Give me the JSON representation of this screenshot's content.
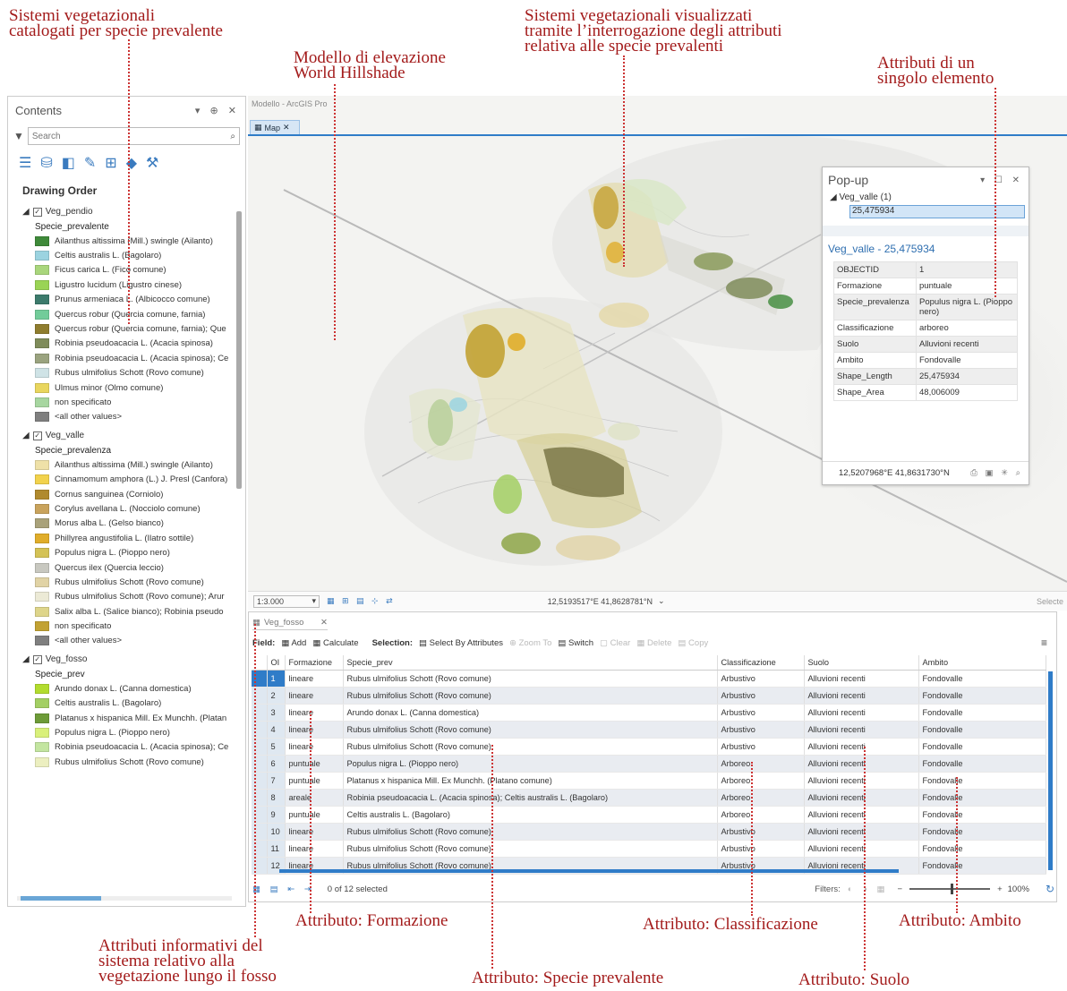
{
  "annotations": {
    "top_left": "Sistemi vegetazionali\ncatalogati per specie prevalente",
    "top_mid": "Modello di elevazione\nWorld Hillshade",
    "top_center": "Sistemi vegetazionali visualizzati\ntramite l’interrogazione degli attributi\nrelativa alle specie prevalenti",
    "top_right": "Attributi di un\nsingolo elemento",
    "bottom_formazione": "Attributo: Formazione",
    "bottom_classificazione": "Attributo: Classificazione",
    "bottom_ambito": "Attributo: Ambito",
    "bottom_left": "Attributi informativi del\nsistema relativo alla\nvegetazione lungo il fosso",
    "bottom_specie": "Attributo: Specie prevalente",
    "bottom_suolo": "Attributo: Suolo"
  },
  "contents": {
    "title": "Contents",
    "controls": "▾ ⊕ ✕",
    "search_placeholder": "Search",
    "drawing_order": "Drawing Order",
    "layers": [
      {
        "name": "Veg_pendio",
        "field": "Specie_prevalente",
        "items": [
          {
            "label": "Ailanthus altissima (Mill.) swingle (Ailanto)",
            "color": "#3f8a3a"
          },
          {
            "label": "Celtis australis L. (Bagolaro)",
            "color": "#9bd3e0"
          },
          {
            "label": "Ficus carica L. (Fico comune)",
            "color": "#a9d67c"
          },
          {
            "label": "Ligustro lucidum (Ligustro cinese)",
            "color": "#9ad455"
          },
          {
            "label": "Prunus armeniaca L. (Albicocco comune)",
            "color": "#3c7b6c"
          },
          {
            "label": "Quercus robur (Quercia comune, farnia)",
            "color": "#72cc9a"
          },
          {
            "label": "Quercus robur (Quercia comune, farnia); Que",
            "color": "#8f7d2e"
          },
          {
            "label": "Robinia pseudoacacia L. (Acacia spinosa)",
            "color": "#7f8c5a"
          },
          {
            "label": "Robinia pseudoacacia L. (Acacia spinosa); Ce",
            "color": "#9aa37f"
          },
          {
            "label": "Rubus ulmifolius Schott (Rovo comune)",
            "color": "#cfe3e6"
          },
          {
            "label": "Ulmus minor (Olmo comune)",
            "color": "#e9d65e"
          },
          {
            "label": "non specificato",
            "color": "#a7d6a0"
          },
          {
            "label": "<all other values>",
            "color": "#7f7f7f"
          }
        ]
      },
      {
        "name": "Veg_valle",
        "field": "Specie_prevalenza",
        "items": [
          {
            "label": "Ailanthus altissima (Mill.) swingle (Ailanto)",
            "color": "#efe1a8"
          },
          {
            "label": "Cinnamomum amphora (L.) J. Presl (Canfora)",
            "color": "#f2d24c"
          },
          {
            "label": "Cornus sanguinea (Corniolo)",
            "color": "#b08a2e"
          },
          {
            "label": "Corylus avellana L. (Nocciolo comune)",
            "color": "#c9a35c"
          },
          {
            "label": "Morus alba L. (Gelso bianco)",
            "color": "#a9a27a"
          },
          {
            "label": "Phillyrea angustifolia L. (Ilatro sottile)",
            "color": "#e0ad2a"
          },
          {
            "label": "Populus nigra L. (Pioppo nero)",
            "color": "#d4c255"
          },
          {
            "label": "Quercus ilex (Quercia leccio)",
            "color": "#c8c8c0"
          },
          {
            "label": "Rubus ulmifolius Schott (Rovo comune)",
            "color": "#e1d3a5"
          },
          {
            "label": "Rubus ulmifolius Schott (Rovo comune); Arur",
            "color": "#ecead6"
          },
          {
            "label": "Salix alba L. (Salice bianco); Robinia pseudo",
            "color": "#ded58a"
          },
          {
            "label": "non specificato",
            "color": "#c2a233"
          },
          {
            "label": "<all other values>",
            "color": "#7f7f7f"
          }
        ]
      },
      {
        "name": "Veg_fosso",
        "field": "Specie_prev",
        "items": [
          {
            "label": "Arundo donax L. (Canna domestica)",
            "color": "#b2dc2e"
          },
          {
            "label": "Celtis australis L. (Bagolaro)",
            "color": "#a3cf63"
          },
          {
            "label": "Platanus x hispanica Mill. Ex Munchh. (Platan",
            "color": "#6d9b38"
          },
          {
            "label": "Populus nigra L. (Pioppo nero)",
            "color": "#d9f07a"
          },
          {
            "label": "Robinia pseudoacacia L. (Acacia spinosa); Ce",
            "color": "#c3e5a0"
          },
          {
            "label": "Rubus ulmifolius Schott (Rovo comune)",
            "color": "#ecefc0"
          }
        ]
      }
    ]
  },
  "map": {
    "app_title": "Modello - ArcGIS Pro",
    "tab_label": "Map",
    "scale": "1:3.000",
    "coordinates": "12,5193517°E 41,8628781°N",
    "selected_label": "Selecte"
  },
  "popup": {
    "title": "Pop-up",
    "controls": "▾ ☐ ✕",
    "tree_layer": "◢ Veg_valle  (1)",
    "tree_value": "25,475934",
    "header": "Veg_valle - 25,475934",
    "rows": [
      {
        "k": "OBJECTID",
        "v": "1"
      },
      {
        "k": "Formazione",
        "v": "puntuale"
      },
      {
        "k": "Specie_prevalenza",
        "v": "Populus nigra L. (Pioppo nero)"
      },
      {
        "k": "Classificazione",
        "v": "arboreo"
      },
      {
        "k": "Suolo",
        "v": "Alluvioni recenti"
      },
      {
        "k": "Ambito",
        "v": "Fondovalle"
      },
      {
        "k": "Shape_Length",
        "v": "25,475934"
      },
      {
        "k": "Shape_Area",
        "v": "48,006009"
      }
    ],
    "footer_coords": "12,5207968°E 41,8631730°N"
  },
  "table": {
    "tab_label": "Veg_fosso",
    "toolbar": {
      "field": "Field:",
      "add": "Add",
      "calculate": "Calculate",
      "selection": "Selection:",
      "select_by_attr": "Select By Attributes",
      "zoom_to": "Zoom To",
      "switch": "Switch",
      "clear": "Clear",
      "delete": "Delete",
      "copy": "Copy"
    },
    "columns": [
      "OI",
      "Formazione",
      "Specie_prev",
      "Classificazione",
      "Suolo",
      "Ambito"
    ],
    "rows": [
      [
        "1",
        "lineare",
        "Rubus ulmifolius Schott (Rovo comune)",
        "Arbustivo",
        "Alluvioni recenti",
        "Fondovalle"
      ],
      [
        "2",
        "lineare",
        "Rubus ulmifolius Schott (Rovo comune)",
        "Arbustivo",
        "Alluvioni recenti",
        "Fondovalle"
      ],
      [
        "3",
        "lineare",
        "Arundo donax L. (Canna domestica)",
        "Arbustivo",
        "Alluvioni recenti",
        "Fondovalle"
      ],
      [
        "4",
        "lineare",
        "Rubus ulmifolius Schott (Rovo comune)",
        "Arbustivo",
        "Alluvioni recenti",
        "Fondovalle"
      ],
      [
        "5",
        "lineare",
        "Rubus ulmifolius Schott (Rovo comune)",
        "Arbustivo",
        "Alluvioni recenti",
        "Fondovalle"
      ],
      [
        "6",
        "puntuale",
        "Populus nigra L. (Pioppo nero)",
        "Arboreo",
        "Alluvioni recenti",
        "Fondovalle"
      ],
      [
        "7",
        "puntuale",
        "Platanus x hispanica Mill. Ex Munchh. (Platano comune)",
        "Arboreo",
        "Alluvioni recenti",
        "Fondovalle"
      ],
      [
        "8",
        "areale",
        "Robinia pseudoacacia L. (Acacia spinosa); Celtis australis L. (Bagolaro)",
        "Arboreo",
        "Alluvioni recenti",
        "Fondovalle"
      ],
      [
        "9",
        "puntuale",
        "Celtis australis L. (Bagolaro)",
        "Arboreo",
        "Alluvioni recenti",
        "Fondovalle"
      ],
      [
        "10",
        "lineare",
        "Rubus ulmifolius Schott (Rovo comune)",
        "Arbustivo",
        "Alluvioni recenti",
        "Fondovalle"
      ],
      [
        "11",
        "lineare",
        "Rubus ulmifolius Schott (Rovo comune)",
        "Arbustivo",
        "Alluvioni recenti",
        "Fondovalle"
      ],
      [
        "12",
        "lineare",
        "Rubus ulmifolius Schott (Rovo comune)",
        "Arbustivo",
        "Alluvioni recenti",
        "Fondovalle"
      ]
    ],
    "footer": {
      "selected": "0 of 12 selected",
      "filters": "Filters:",
      "zoom": "100%"
    }
  }
}
